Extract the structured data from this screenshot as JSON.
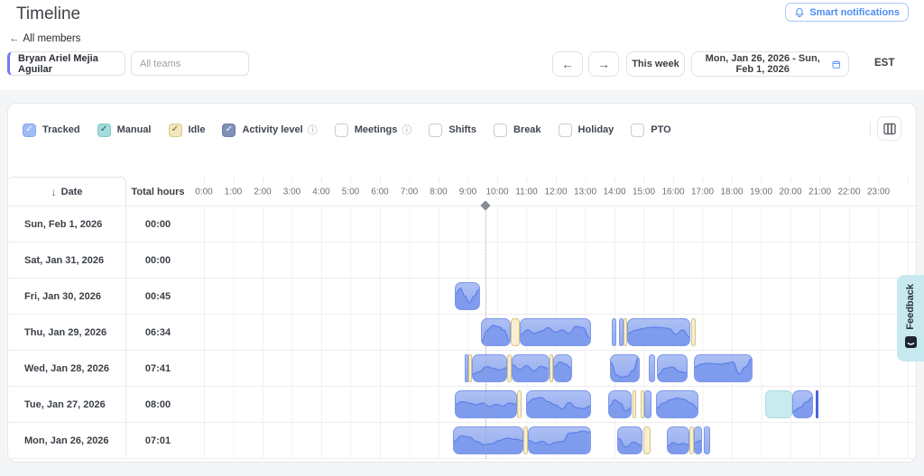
{
  "header": {
    "title": "Timeline",
    "back_link": "All members",
    "member_filter_value": "Bryan Ariel Mejia Aguilar",
    "teams_placeholder": "All teams",
    "smart_notifications_label": "Smart notifications",
    "this_week_label": "This week",
    "date_range": "Mon, Jan 26, 2026 - Sun, Feb 1, 2026",
    "timezone": "EST"
  },
  "filters": [
    {
      "label": "Tracked",
      "checked": true,
      "bg": "#9fbcf5",
      "border": "#86a8ef",
      "check": "#ffffff",
      "info": false
    },
    {
      "label": "Manual",
      "checked": true,
      "bg": "#a2dcdc",
      "border": "#7ec9c9",
      "check": "#2c4a4a",
      "info": false
    },
    {
      "label": "Idle",
      "checked": true,
      "bg": "#f2e7bd",
      "border": "#dcc98e",
      "check": "#6e5f2e",
      "info": false
    },
    {
      "label": "Activity level",
      "checked": true,
      "bg": "#7c90b8",
      "border": "#6a7fa8",
      "check": "#ffffff",
      "info": true
    },
    {
      "label": "Meetings",
      "checked": false,
      "bg": "#ffffff",
      "border": "#c9ccd3",
      "check": "",
      "info": true
    },
    {
      "label": "Shifts",
      "checked": false,
      "bg": "#ffffff",
      "border": "#c9ccd3",
      "check": "",
      "info": false
    },
    {
      "label": "Break",
      "checked": false,
      "bg": "#ffffff",
      "border": "#c9ccd3",
      "check": "",
      "info": false
    },
    {
      "label": "Holiday",
      "checked": false,
      "bg": "#ffffff",
      "border": "#c9ccd3",
      "check": "",
      "info": false
    },
    {
      "label": "PTO",
      "checked": false,
      "bg": "#ffffff",
      "border": "#c9ccd3",
      "check": "",
      "info": false
    }
  ],
  "chart_data": {
    "type": "timeline",
    "date_header": "Date",
    "total_header": "Total hours",
    "hour_labels": [
      "0:00",
      "1:00",
      "2:00",
      "3:00",
      "4:00",
      "5:00",
      "6:00",
      "7:00",
      "8:00",
      "9:00",
      "10:00",
      "11:00",
      "12:00",
      "13:00",
      "14:00",
      "15:00",
      "16:00",
      "17:00",
      "18:00",
      "19:00",
      "20:00",
      "21:00",
      "22:00",
      "23:00"
    ],
    "axis_range_hours": [
      0,
      24
    ],
    "current_time_hour": 9.6,
    "rows": [
      {
        "date": "Sun, Feb 1, 2026",
        "total": "00:00",
        "segments": []
      },
      {
        "date": "Sat, Jan 31, 2026",
        "total": "00:00",
        "segments": []
      },
      {
        "date": "Fri, Jan 30, 2026",
        "total": "00:45",
        "segments": [
          {
            "t": "tracked",
            "s": 8.55,
            "e": 9.4,
            "a": [
              0.6,
              0.85,
              0.5,
              0.2,
              0.5,
              0.8
            ]
          }
        ]
      },
      {
        "date": "Thu, Jan 29, 2026",
        "total": "06:34",
        "segments": [
          {
            "t": "tracked",
            "s": 9.45,
            "e": 10.45,
            "a": [
              0.1,
              0.6,
              0.8,
              0.75,
              0.6,
              0.15
            ]
          },
          {
            "t": "idle",
            "s": 10.45,
            "e": 10.78
          },
          {
            "t": "tracked",
            "s": 10.78,
            "e": 13.2,
            "a": [
              0.4,
              0.6,
              0.45,
              0.55,
              0.7,
              0.5,
              0.6,
              0.45,
              0.75,
              0.7,
              0.25
            ]
          },
          {
            "t": "tracked",
            "s": 13.9,
            "e": 14.07,
            "a": [
              0.5,
              0.55
            ]
          },
          {
            "t": "tracked",
            "s": 14.14,
            "e": 14.3,
            "a": [
              0.55,
              0.5
            ]
          },
          {
            "t": "idle",
            "s": 14.3,
            "e": 14.44
          },
          {
            "t": "tracked",
            "s": 14.44,
            "e": 16.6,
            "a": [
              0.45,
              0.58,
              0.65,
              0.7,
              0.72,
              0.7,
              0.66,
              0.4,
              0.6,
              0.28
            ]
          },
          {
            "t": "idle",
            "s": 16.62,
            "e": 16.76
          }
        ]
      },
      {
        "date": "Wed, Jan 28, 2026",
        "total": "07:41",
        "segments": [
          {
            "t": "tracked",
            "s": 8.9,
            "e": 9.0,
            "a": [
              0.4,
              0.45
            ]
          },
          {
            "t": "idle",
            "s": 9.0,
            "e": 9.14
          },
          {
            "t": "tracked",
            "s": 9.14,
            "e": 10.35,
            "a": [
              0.25,
              0.35,
              0.58,
              0.5,
              0.42,
              0.52
            ]
          },
          {
            "t": "idle",
            "s": 10.35,
            "e": 10.5
          },
          {
            "t": "tracked",
            "s": 10.5,
            "e": 11.77,
            "a": [
              0.65,
              0.45,
              0.62,
              0.38,
              0.58,
              0.5
            ]
          },
          {
            "t": "idle",
            "s": 11.77,
            "e": 11.9
          },
          {
            "t": "tracked",
            "s": 11.9,
            "e": 12.55,
            "a": [
              0.55,
              0.78,
              0.68,
              0.5
            ]
          },
          {
            "t": "tracked",
            "s": 13.85,
            "e": 14.85,
            "a": [
              0.75,
              0.2,
              0.1,
              0.15,
              0.4,
              0.95
            ]
          },
          {
            "t": "tracked",
            "s": 15.17,
            "e": 15.4,
            "a": [
              0.3,
              0.5
            ]
          },
          {
            "t": "tracked",
            "s": 15.45,
            "e": 16.5,
            "a": [
              0.2,
              0.5,
              0.55,
              0.35,
              0.3
            ]
          },
          {
            "t": "tracked",
            "s": 16.7,
            "e": 18.7,
            "a": [
              0.55,
              0.68,
              0.72,
              0.7,
              0.68,
              0.72,
              0.78,
              0.25,
              0.55,
              0.92
            ]
          }
        ]
      },
      {
        "date": "Tue, Jan 27, 2026",
        "total": "08:00",
        "segments": [
          {
            "t": "tracked",
            "s": 8.55,
            "e": 10.68,
            "a": [
              0.5,
              0.62,
              0.55,
              0.48,
              0.55,
              0.4,
              0.5,
              0.42,
              0.56,
              0.5
            ]
          },
          {
            "t": "idle",
            "s": 10.68,
            "e": 10.83
          },
          {
            "t": "tracked",
            "s": 10.98,
            "e": 13.2,
            "a": [
              0.55,
              0.75,
              0.8,
              0.62,
              0.48,
              0.3,
              0.58,
              0.35,
              0.3,
              0.42
            ]
          },
          {
            "t": "tracked",
            "s": 13.78,
            "e": 14.6,
            "a": [
              0.4,
              0.7,
              0.55,
              0.2,
              0.35
            ]
          },
          {
            "t": "idle",
            "s": 14.6,
            "e": 14.74
          },
          {
            "t": "idle",
            "s": 14.88,
            "e": 15.02
          },
          {
            "t": "tracked",
            "s": 15.02,
            "e": 15.25,
            "a": [
              0.6,
              0.3
            ]
          },
          {
            "t": "tracked",
            "s": 15.4,
            "e": 16.85,
            "a": [
              0.35,
              0.55,
              0.7,
              0.78,
              0.72,
              0.55,
              0.32
            ]
          },
          {
            "t": "manual",
            "s": 19.15,
            "e": 20.05
          },
          {
            "t": "tracked",
            "s": 20.05,
            "e": 20.78,
            "a": [
              0.18,
              0.35,
              0.6,
              0.82
            ]
          },
          {
            "t": "line",
            "s": 20.86,
            "e": 20.94
          }
        ]
      },
      {
        "date": "Mon, Jan 26, 2026",
        "total": "07:01",
        "segments": [
          {
            "t": "tracked",
            "s": 8.5,
            "e": 10.9,
            "a": [
              0.45,
              0.7,
              0.65,
              0.45,
              0.3,
              0.35,
              0.5,
              0.6,
              0.55,
              0.5
            ]
          },
          {
            "t": "idle",
            "s": 10.9,
            "e": 11.06
          },
          {
            "t": "tracked",
            "s": 11.06,
            "e": 13.2,
            "a": [
              0.5,
              0.38,
              0.46,
              0.3,
              0.42,
              0.45,
              0.82,
              0.85,
              0.92,
              0.86
            ]
          },
          {
            "t": "tracked",
            "s": 14.1,
            "e": 14.95,
            "a": [
              0.6,
              0.2,
              0.42,
              0.28
            ]
          },
          {
            "t": "idle",
            "s": 14.98,
            "e": 15.23
          },
          {
            "t": "tracked",
            "s": 15.78,
            "e": 16.55,
            "a": [
              0.25,
              0.4,
              0.32,
              0.36,
              0.3
            ]
          },
          {
            "t": "idle",
            "s": 16.55,
            "e": 16.7
          },
          {
            "t": "tracked",
            "s": 16.7,
            "e": 16.98,
            "a": [
              0.4,
              0.5
            ]
          },
          {
            "t": "tracked",
            "s": 17.05,
            "e": 17.25,
            "a": [
              0.5,
              0.55
            ]
          }
        ]
      }
    ]
  },
  "colors": {
    "tracked_fill_top": "#adc0f4",
    "tracked_fill_bottom": "#93aaef",
    "tracked_border": "#7e98e8",
    "wave_fill": "#7b99ec",
    "wave_stroke": "#5f82e8",
    "idle_fill": "#f7efcf",
    "idle_border": "#d6c386",
    "manual_fill": "#c9ebee",
    "accent_blue": "#4c8df6",
    "feedback_bg": "#c7e9ef"
  },
  "feedback": {
    "label": "Feedback"
  }
}
